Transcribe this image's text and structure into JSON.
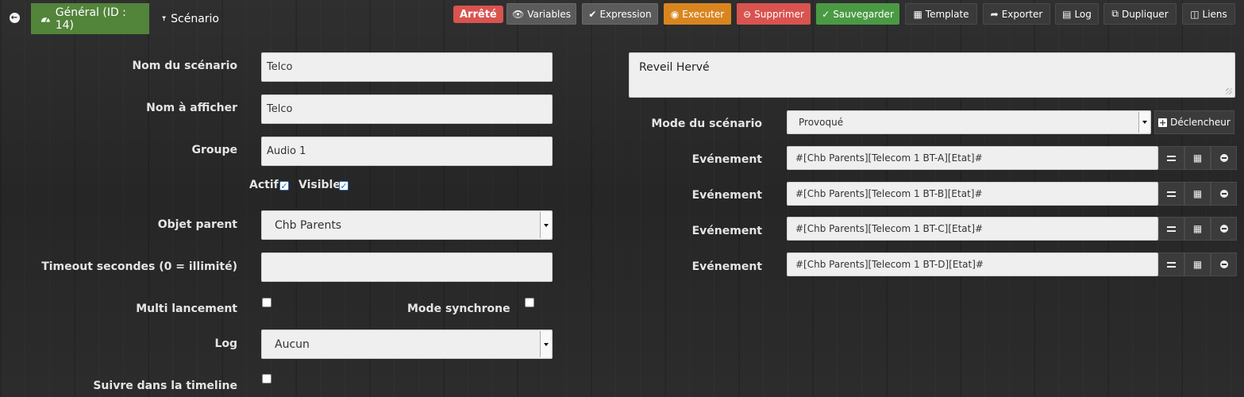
{
  "topbar": {
    "tabs": [
      {
        "label": "Général (ID : 14)",
        "icon": "dashboard-icon"
      },
      {
        "label": "Scénario",
        "icon": "filter-icon"
      }
    ],
    "status": "Arrêté",
    "buttons": [
      {
        "label": "Variables",
        "icon": "eye-icon"
      },
      {
        "label": "Expression",
        "icon": "check-icon"
      },
      {
        "label": "Executer",
        "icon": "gamepad-icon"
      },
      {
        "label": "Supprimer",
        "icon": "minus-circle-icon"
      },
      {
        "label": "Sauvegarder",
        "icon": "check-circle-icon"
      },
      {
        "label": "Template",
        "icon": "cubes-icon"
      },
      {
        "label": "Exporter",
        "icon": "share-icon"
      },
      {
        "label": "Log",
        "icon": "file-icon"
      },
      {
        "label": "Dupliquer",
        "icon": "copy-icon"
      },
      {
        "label": "Liens",
        "icon": "sitemap-icon"
      }
    ]
  },
  "form": {
    "name_label": "Nom du scénario",
    "name_value": "Telco",
    "display_label": "Nom à afficher",
    "display_value": "Telco",
    "group_label": "Groupe",
    "group_value": "Audio 1",
    "active_label": "Actif",
    "active_checked": true,
    "visible_label": "Visible",
    "visible_checked": true,
    "parent_label": "Objet parent",
    "parent_value": "Chb Parents",
    "timeout_label": "Timeout secondes (0 = illimité)",
    "timeout_value": "",
    "multi_label": "Multi lancement",
    "multi_checked": false,
    "sync_label": "Mode synchrone",
    "sync_checked": false,
    "log_label": "Log",
    "log_value": "Aucun",
    "timeline_label": "Suivre dans la timeline",
    "timeline_checked": false
  },
  "right": {
    "description": "Reveil Hervé",
    "mode_label": "Mode du scénario",
    "mode_value": "Provoqué",
    "trigger_button": "Déclencheur",
    "events": [
      {
        "label": "Evénement",
        "value": "#[Chb Parents][Telecom 1 BT-A][Etat]#"
      },
      {
        "label": "Evénement",
        "value": "#[Chb Parents][Telecom 1 BT-B][Etat]#"
      },
      {
        "label": "Evénement",
        "value": "#[Chb Parents][Telecom 1 BT-C][Etat]#"
      },
      {
        "label": "Evénement",
        "value": "#[Chb Parents][Telecom 1 BT-D][Etat]#"
      }
    ]
  }
}
